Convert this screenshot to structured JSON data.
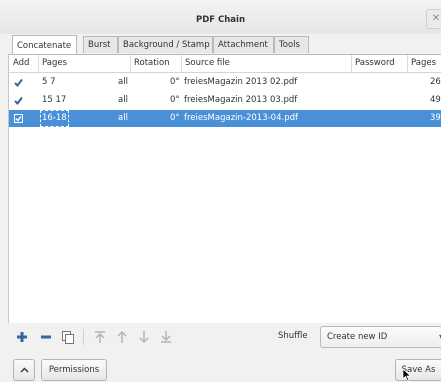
{
  "window": {
    "title": "PDF Chain",
    "close_icon": "close-icon"
  },
  "tabs": [
    {
      "label": "Concatenate",
      "active": true
    },
    {
      "label": "Burst",
      "active": false
    },
    {
      "label": "Background / Stamp",
      "active": false
    },
    {
      "label": "Attachment",
      "active": false
    },
    {
      "label": "Tools",
      "active": false
    }
  ],
  "table": {
    "columns": [
      "Add",
      "Pages",
      "Rotation",
      "Source file",
      "Password",
      "Pages"
    ],
    "rows": [
      {
        "checked": true,
        "pages": "5 7",
        "filter": "all",
        "rotation": "0°",
        "source": "freiesMagazin 2013 02.pdf",
        "total": "26",
        "selected": false
      },
      {
        "checked": true,
        "pages": "15 17",
        "filter": "all",
        "rotation": "0°",
        "source": "freiesMagazin 2013 03.pdf",
        "total": "49",
        "selected": false
      },
      {
        "checked": true,
        "pages": "16-18",
        "filter": "all",
        "rotation": "0°",
        "source": "freiesMagazin-2013-04.pdf",
        "total": "39",
        "selected": true
      }
    ]
  },
  "toolbar": {
    "icons": [
      "add-icon",
      "remove-icon",
      "copy-icon",
      "move-top-icon",
      "move-up-icon",
      "move-down-icon",
      "move-bottom-icon"
    ],
    "shuffle_label": "Shuffle",
    "shuffle_value": "Create new ID"
  },
  "footer": {
    "expand_icon": "chevron-up-icon",
    "permissions_label": "Permissions",
    "save_label": "Save As"
  },
  "colors": {
    "selection": "#4a90d9",
    "accent_blue": "#3465a4"
  }
}
